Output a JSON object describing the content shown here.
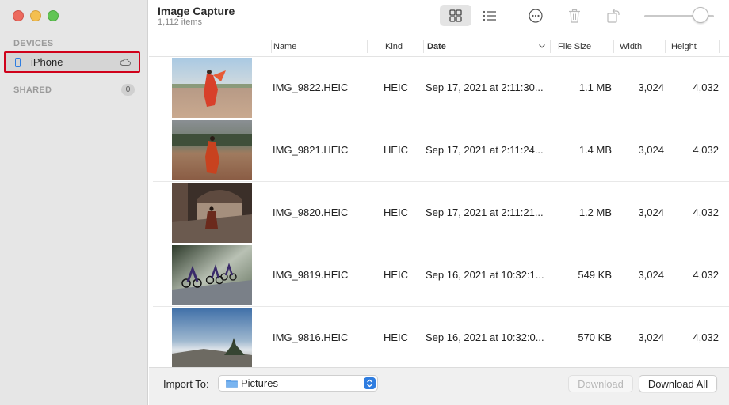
{
  "window": {
    "title": "Image Capture",
    "subtitle": "1,112 items"
  },
  "sidebar": {
    "devices_label": "DEVICES",
    "device": {
      "name": "iPhone",
      "icon": "iphone-icon",
      "status_icon": "cloud-icon"
    },
    "shared_label": "SHARED",
    "shared_count": "0"
  },
  "toolbar": {
    "view_grid_icon": "grid-view-icon",
    "view_list_icon": "list-view-icon",
    "more_icon": "ellipsis-circle-icon",
    "delete_icon": "trash-icon",
    "rotate_icon": "rotate-icon",
    "thumbnail_size_slider": 0.82
  },
  "table": {
    "columns": [
      "Name",
      "Kind",
      "Date",
      "File Size",
      "Width",
      "Height"
    ],
    "sorted_column": "Date",
    "rows": [
      {
        "name": "IMG_9822.HEIC",
        "kind": "HEIC",
        "date": "Sep 17, 2021 at 2:11:30...",
        "size": "1.1 MB",
        "width": "3,024",
        "height": "4,032"
      },
      {
        "name": "IMG_9821.HEIC",
        "kind": "HEIC",
        "date": "Sep 17, 2021 at 2:11:24...",
        "size": "1.4 MB",
        "width": "3,024",
        "height": "4,032"
      },
      {
        "name": "IMG_9820.HEIC",
        "kind": "HEIC",
        "date": "Sep 17, 2021 at 2:11:21...",
        "size": "1.2 MB",
        "width": "3,024",
        "height": "4,032"
      },
      {
        "name": "IMG_9819.HEIC",
        "kind": "HEIC",
        "date": "Sep 16, 2021 at 10:32:1...",
        "size": "549 KB",
        "width": "3,024",
        "height": "4,032"
      },
      {
        "name": "IMG_9816.HEIC",
        "kind": "HEIC",
        "date": "Sep 16, 2021 at 10:32:0...",
        "size": "570 KB",
        "width": "3,024",
        "height": "4,032"
      }
    ]
  },
  "bottom": {
    "import_label": "Import To:",
    "import_value": "Pictures",
    "download_label": "Download",
    "download_all_label": "Download All"
  },
  "colors": {
    "accent": "#2f7de0",
    "highlight_border": "#d0021b"
  }
}
